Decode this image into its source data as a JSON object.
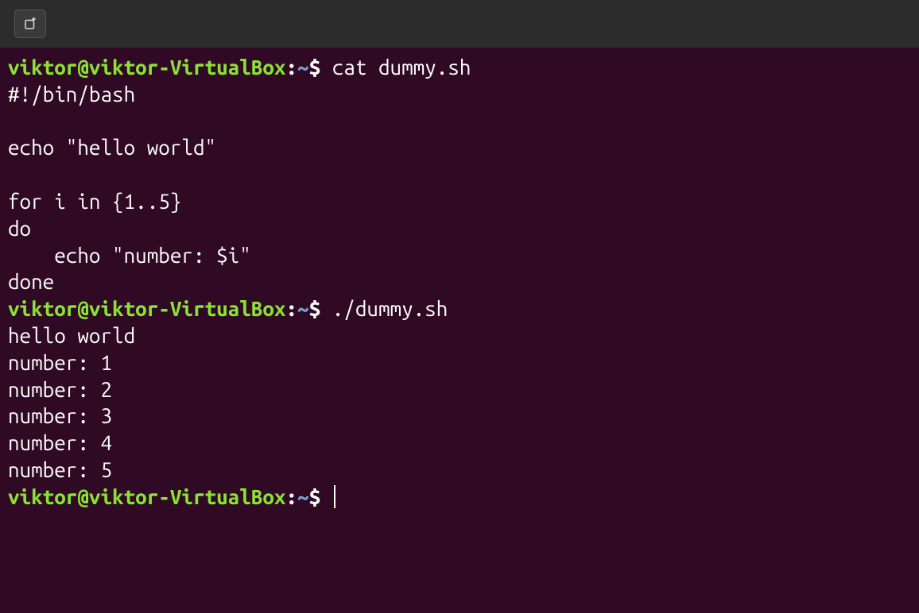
{
  "prompt": {
    "user_host": "viktor@viktor-VirtualBox",
    "colon": ":",
    "path": "~",
    "dollar": "$ "
  },
  "lines": [
    {
      "type": "prompt",
      "command": "cat dummy.sh"
    },
    {
      "type": "output",
      "text": "#!/bin/bash"
    },
    {
      "type": "output",
      "text": ""
    },
    {
      "type": "output",
      "text": "echo \"hello world\""
    },
    {
      "type": "output",
      "text": ""
    },
    {
      "type": "output",
      "text": "for i in {1..5}"
    },
    {
      "type": "output",
      "text": "do"
    },
    {
      "type": "output",
      "text": "    echo \"number: $i\""
    },
    {
      "type": "output",
      "text": "done"
    },
    {
      "type": "prompt",
      "command": "./dummy.sh"
    },
    {
      "type": "output",
      "text": "hello world"
    },
    {
      "type": "output",
      "text": "number: 1"
    },
    {
      "type": "output",
      "text": "number: 2"
    },
    {
      "type": "output",
      "text": "number: 3"
    },
    {
      "type": "output",
      "text": "number: 4"
    },
    {
      "type": "output",
      "text": "number: 5"
    },
    {
      "type": "prompt",
      "command": "",
      "cursor": true
    }
  ]
}
